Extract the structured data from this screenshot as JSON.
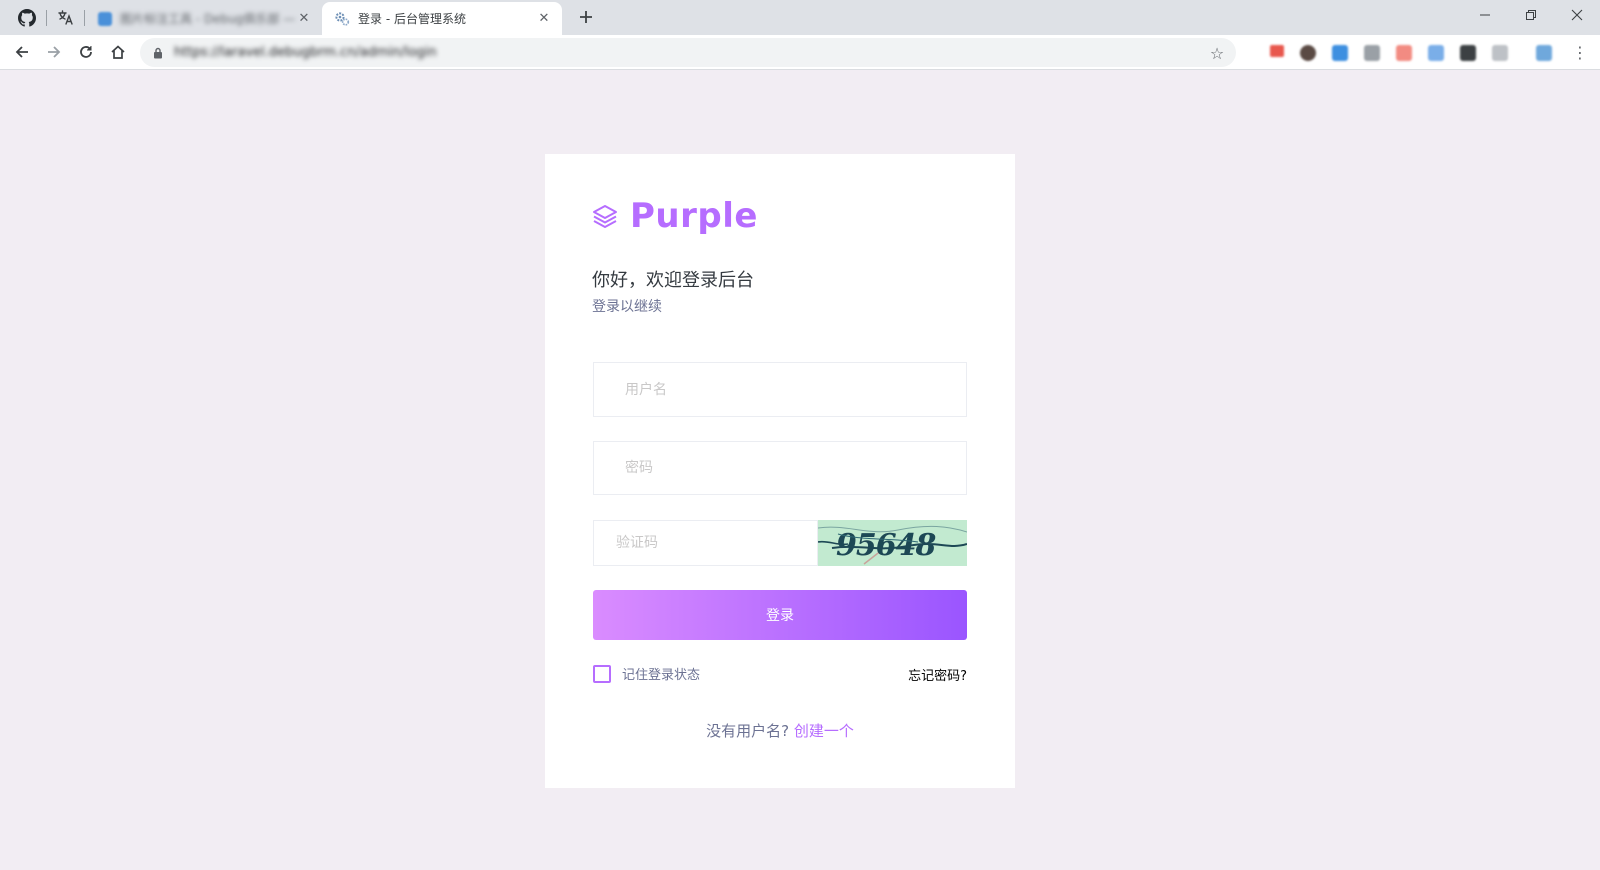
{
  "browser": {
    "tabs": [
      {
        "title": "图片标注工具 - Debug俱乐部 — 社区",
        "active": false
      },
      {
        "title": "登录 - 后台管理系统",
        "active": true
      }
    ],
    "url": "https://laravel.debugbrm.cn/admin/login",
    "icons": {
      "back": "back-arrow-icon",
      "forward": "forward-arrow-icon",
      "reload": "reload-icon",
      "home": "home-icon",
      "bookmark": "star-icon",
      "menu": "more-vert-icon"
    }
  },
  "login": {
    "brand": "Purple",
    "greeting": "你好，欢迎登录后台",
    "subtitle": "登录以继续",
    "username_placeholder": "用户名",
    "password_placeholder": "密码",
    "captcha_placeholder": "验证码",
    "captcha_text": "95648",
    "submit_label": "登录",
    "remember_label": "记住登录状态",
    "forgot_label": "忘记密码?",
    "no_account_text": "没有用户名?",
    "signup_link": "创建一个"
  },
  "colors": {
    "accent": "#b66dff",
    "button_gradient_start": "#da8cff",
    "button_gradient_end": "#9a55ff",
    "page_background": "#f2edf3",
    "captcha_background": "#c2ead0"
  }
}
